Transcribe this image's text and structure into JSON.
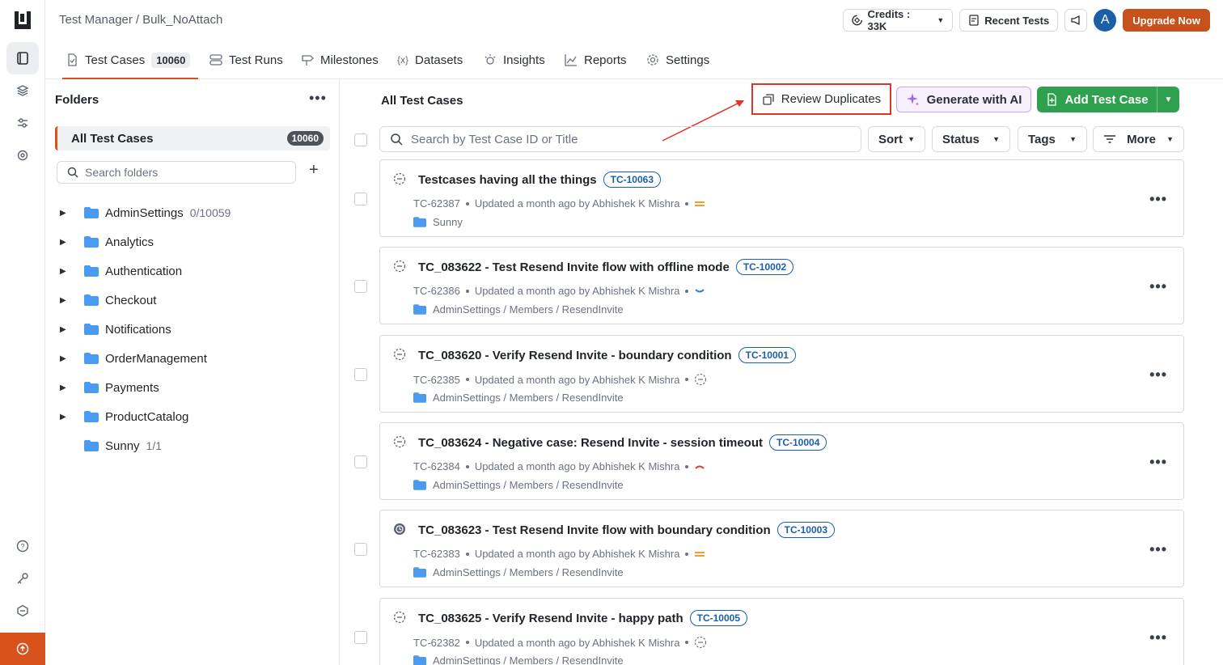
{
  "breadcrumb": {
    "root": "Test Manager",
    "sep": "/",
    "current": "Bulk_NoAttach"
  },
  "topbar": {
    "credits": "Credits : 33K",
    "recent_tests": "Recent Tests",
    "avatar_initial": "A",
    "upgrade": "Upgrade Now"
  },
  "tabs": [
    {
      "label": "Test Cases",
      "count": "10060",
      "icon": "test-cases-icon"
    },
    {
      "label": "Test Runs",
      "icon": "test-runs-icon"
    },
    {
      "label": "Milestones",
      "icon": "milestone-icon"
    },
    {
      "label": "Datasets",
      "icon": "dataset-icon"
    },
    {
      "label": "Insights",
      "icon": "insights-icon"
    },
    {
      "label": "Reports",
      "icon": "reports-icon"
    },
    {
      "label": "Settings",
      "icon": "gear-icon"
    }
  ],
  "folders": {
    "header": "Folders",
    "all_label": "All Test Cases",
    "all_count": "10060",
    "search_placeholder": "Search folders",
    "items": [
      {
        "name": "AdminSettings",
        "meta": "0/10059",
        "expandable": true
      },
      {
        "name": "Analytics",
        "meta": "",
        "expandable": true
      },
      {
        "name": "Authentication",
        "meta": "",
        "expandable": true
      },
      {
        "name": "Checkout",
        "meta": "",
        "expandable": true
      },
      {
        "name": "Notifications",
        "meta": "",
        "expandable": true
      },
      {
        "name": "OrderManagement",
        "meta": "",
        "expandable": true
      },
      {
        "name": "Payments",
        "meta": "",
        "expandable": true
      },
      {
        "name": "ProductCatalog",
        "meta": "",
        "expandable": true
      },
      {
        "name": "Sunny",
        "meta": "1/1",
        "expandable": false
      }
    ]
  },
  "main": {
    "title": "All Test Cases",
    "review_duplicates": "Review Duplicates",
    "generate_ai": "Generate with AI",
    "add_test_case": "Add Test Case",
    "search_placeholder": "Search by Test Case ID or Title",
    "filters": {
      "sort": "Sort",
      "status": "Status",
      "tags": "Tags",
      "more": "More"
    }
  },
  "test_cases": [
    {
      "title": "Testcases having all the things",
      "tc": "TC-10063",
      "id": "TC-62387",
      "updated": "Updated a month ago by Abhishek K Mishra",
      "priority": "medium",
      "path": "Sunny",
      "status": "draft"
    },
    {
      "title": "TC_083622 - Test Resend Invite flow with offline mode",
      "tc": "TC-10002",
      "id": "TC-62386",
      "updated": "Updated a month ago by Abhishek K Mishra",
      "priority": "low",
      "path": "AdminSettings / Members / ResendInvite",
      "status": "draft"
    },
    {
      "title": "TC_083620 - Verify Resend Invite - boundary condition",
      "tc": "TC-10001",
      "id": "TC-62385",
      "updated": "Updated a month ago by Abhishek K Mishra",
      "priority": "not-set",
      "path": "AdminSettings / Members / ResendInvite",
      "status": "draft"
    },
    {
      "title": "TC_083624 - Negative case: Resend Invite - session timeout",
      "tc": "TC-10004",
      "id": "TC-62384",
      "updated": "Updated a month ago by Abhishek K Mishra",
      "priority": "high",
      "path": "AdminSettings / Members / ResendInvite",
      "status": "draft"
    },
    {
      "title": "TC_083623 - Test Resend Invite flow with boundary condition",
      "tc": "TC-10003",
      "id": "TC-62383",
      "updated": "Updated a month ago by Abhishek K Mishra",
      "priority": "medium",
      "path": "AdminSettings / Members / ResendInvite",
      "status": "in-review"
    },
    {
      "title": "TC_083625 - Verify Resend Invite - happy path",
      "tc": "TC-10005",
      "id": "TC-62382",
      "updated": "Updated a month ago by Abhishek K Mishra",
      "priority": "not-set",
      "path": "AdminSettings / Members / ResendInvite",
      "status": "draft"
    }
  ],
  "colors": {
    "accent": "#d8531c",
    "brand_blue": "#1a5fa8",
    "add_green": "#2fa04e",
    "highlight_red": "#e0342a"
  }
}
